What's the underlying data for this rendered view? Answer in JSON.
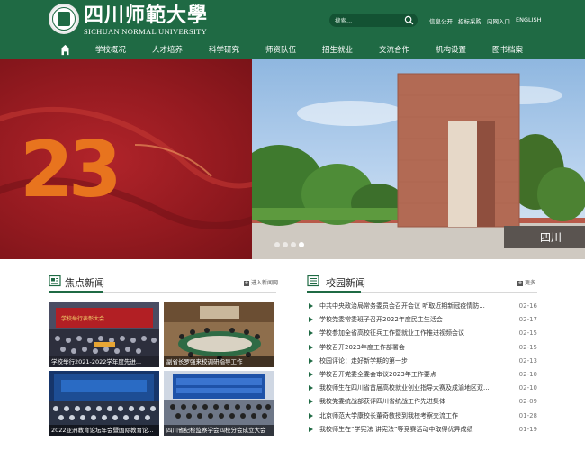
{
  "header": {
    "logo_cn": "四川师範大學",
    "logo_en": "SICHUAN NORMAL UNIVERSITY",
    "search_placeholder": "搜索...",
    "top_links": [
      "信息公开",
      "招标采购",
      "内网入口",
      "ENGLISH"
    ]
  },
  "nav": {
    "items": [
      "学校概况",
      "人才培养",
      "科学研究",
      "师资队伍",
      "招生就业",
      "交流合作",
      "机构设置",
      "图书档案"
    ]
  },
  "banner": {
    "big_number": "23",
    "slide_count": 4,
    "active_slide": 4
  },
  "focus_news": {
    "title": "焦点新闻",
    "more_label": "进入新闻网",
    "items": [
      {
        "caption": "学校举行2021-2022学年度先进..."
      },
      {
        "caption": "副省长罗强来校调研指导工作"
      },
      {
        "caption": "2022亚洲教育论坛年会暨国际教育论..."
      },
      {
        "caption": "四川省纪检监察学会四校分会成立大会"
      }
    ]
  },
  "campus_news": {
    "title": "校园新闻",
    "more_label": "更多",
    "items": [
      {
        "title": "中共中央政治局常务委员会召开会议 听取近期新冠疫情防...",
        "date": "02-16"
      },
      {
        "title": "学校党委常委班子召开2022年度民主生活会",
        "date": "02-17"
      },
      {
        "title": "学校参加全省高校征兵工作暨就业工作推进视频会议",
        "date": "02-15"
      },
      {
        "title": "学校召开2023年度工作部署会",
        "date": "02-15"
      },
      {
        "title": "校园评论：走好新学期的第一步",
        "date": "02-13"
      },
      {
        "title": "学校召开党委全委会审议2023年工作要点",
        "date": "02-10"
      },
      {
        "title": "我校师生在四川省首届高校就业创业指导大赛及成渝地区双...",
        "date": "02-10"
      },
      {
        "title": "我校党委统战部获评四川省统战工作先进集体",
        "date": "02-09"
      },
      {
        "title": "北京师范大学康校长董奇教授到我校考察交流工作",
        "date": "01-28"
      },
      {
        "title": "我校师生在“学宪法 讲宪法”等竞赛活动中取得优异成绩",
        "date": "01-19"
      }
    ]
  },
  "colors": {
    "brand_green": "#1f6a44",
    "banner_red": "#941a20",
    "accent_orange": "#e0641c"
  }
}
